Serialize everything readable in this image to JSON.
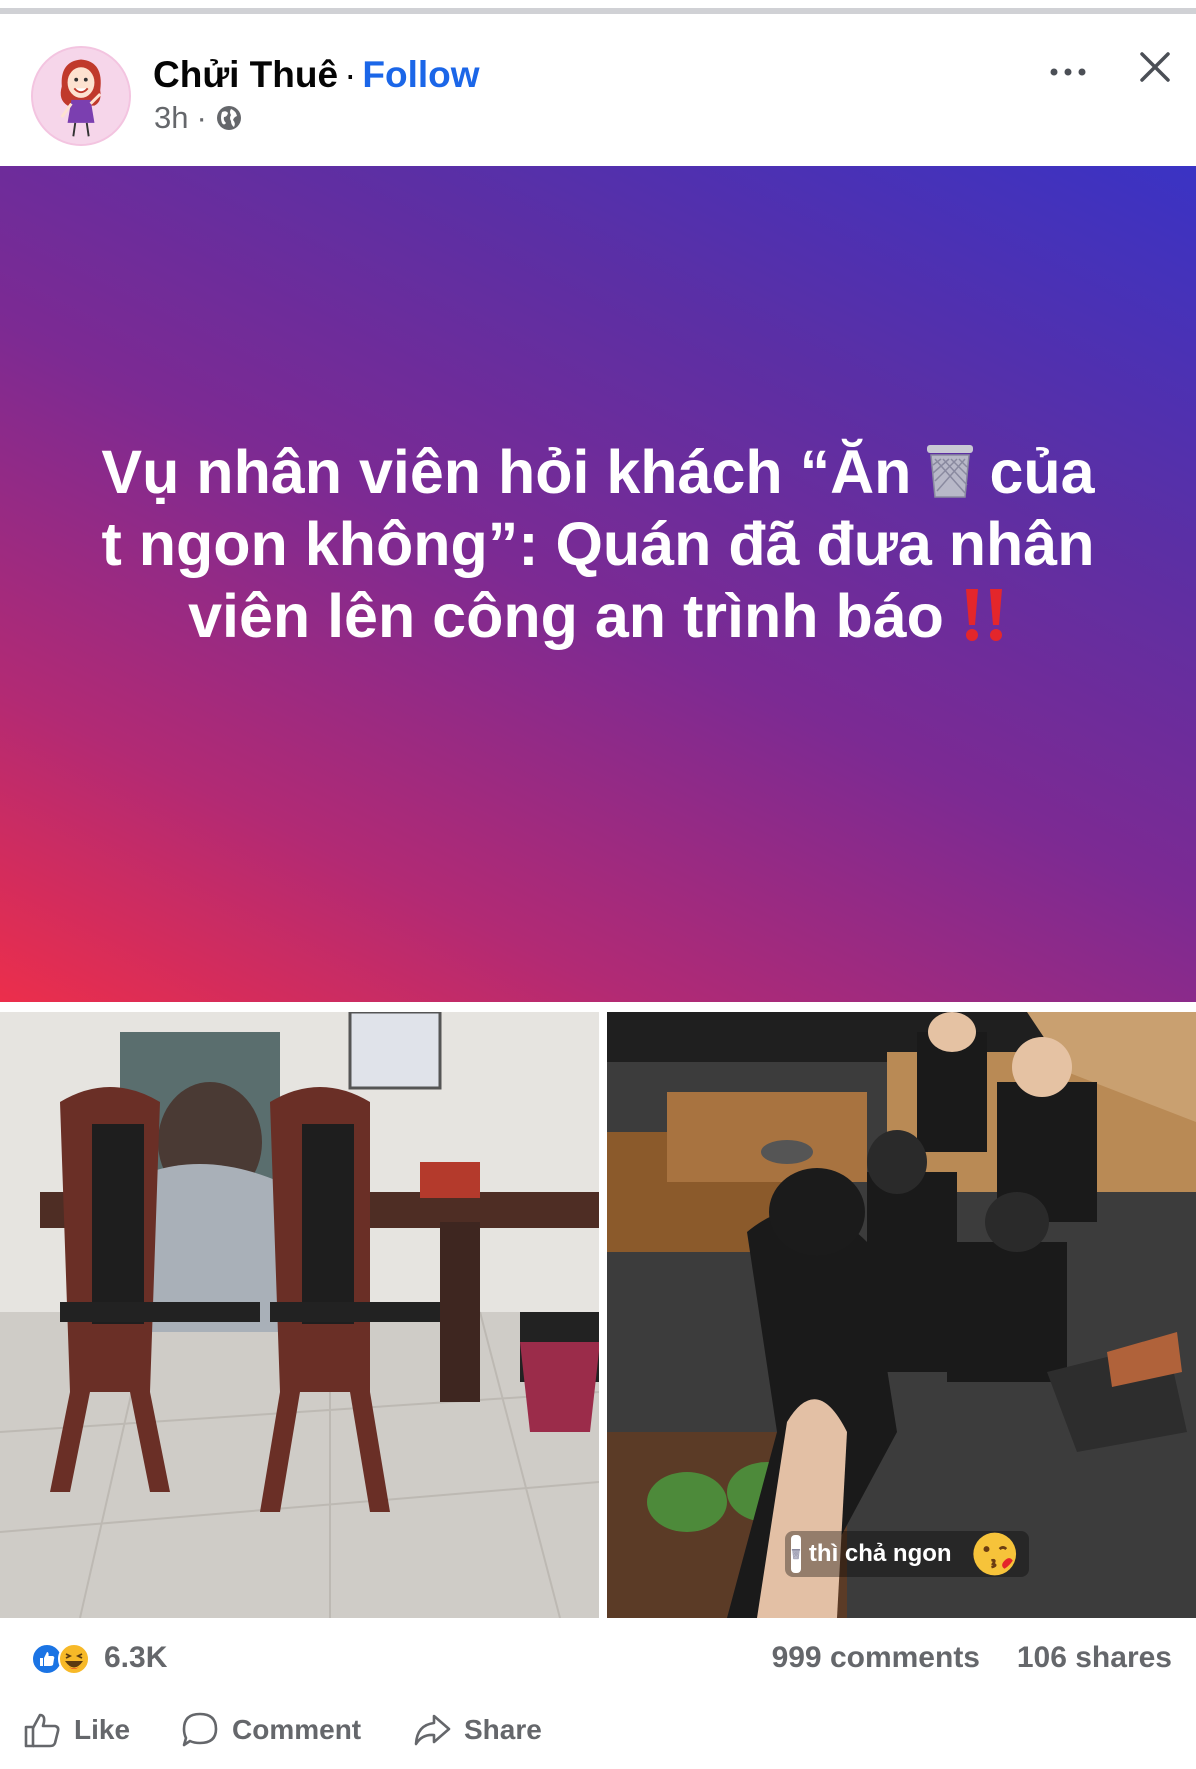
{
  "post": {
    "author": "Chửi Thuê",
    "separator": "·",
    "follow_label": "Follow",
    "time": "3h",
    "time_separator": "·",
    "privacy_icon": "globe-icon",
    "more_icon": "more-icon",
    "close_icon": "close-icon"
  },
  "banner": {
    "line1_a": "Vụ nhân viên hỏi khách “Ăn",
    "line1_emoji": "wastebasket-icon",
    "line1_b": "của",
    "line2": "t ngon không”: Quán đã đưa nhân",
    "line3": "viên lên công an trình báo",
    "line3_emoji": "double-exclamation-icon",
    "gradient": [
      "#ec2e4b",
      "#7c2a93",
      "#3a33c4"
    ]
  },
  "photos": {
    "right_caption": "thì chả ngon",
    "right_caption_emoji": "kissing-face-icon"
  },
  "stats": {
    "reaction_icons": [
      "like-icon",
      "haha-icon"
    ],
    "reaction_count": "6.3K",
    "comments": "999 comments",
    "shares": "106 shares"
  },
  "actions": {
    "like": "Like",
    "comment": "Comment",
    "share": "Share"
  },
  "colors": {
    "accent": "#1b66e8",
    "muted": "#65676b",
    "alert": "#e4262b"
  }
}
